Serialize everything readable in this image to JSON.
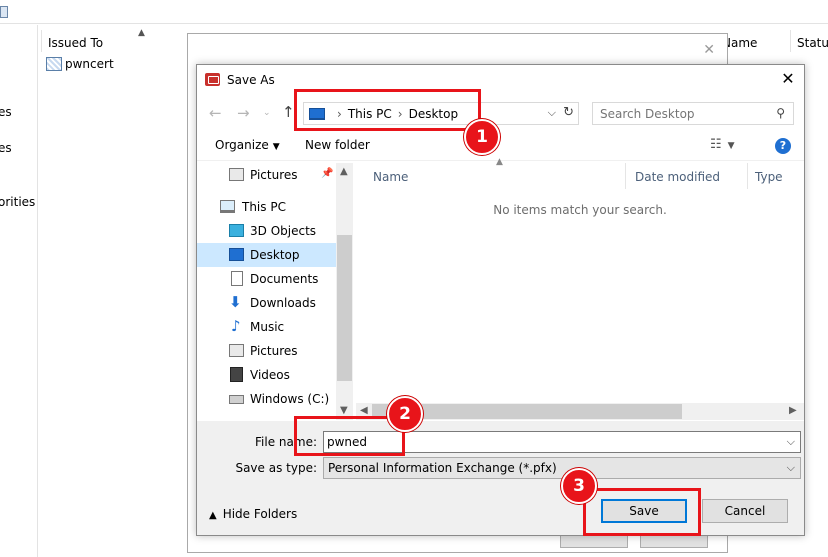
{
  "background": {
    "columns": {
      "issued_to": "Issued To",
      "name": "Name",
      "status": "Status"
    },
    "row": {
      "issued_to": "pwncert"
    },
    "tree_fragments": [
      "es",
      "es",
      "orities"
    ]
  },
  "dialog": {
    "title": "Save As",
    "breadcrumb": [
      "This PC",
      "Desktop"
    ],
    "search_placeholder": "Search Desktop",
    "toolbar": {
      "organize": "Organize",
      "new_folder": "New folder"
    },
    "nav_items": [
      {
        "label": "Pictures",
        "icon": "pictures-icon",
        "indent": 1,
        "pinned": true
      },
      {
        "label": "This PC",
        "icon": "this-pc-icon",
        "indent": 0
      },
      {
        "label": "3D Objects",
        "icon": "3d-objects-icon",
        "indent": 1
      },
      {
        "label": "Desktop",
        "icon": "desktop-icon",
        "indent": 1,
        "selected": true
      },
      {
        "label": "Documents",
        "icon": "documents-icon",
        "indent": 1
      },
      {
        "label": "Downloads",
        "icon": "downloads-icon",
        "indent": 1
      },
      {
        "label": "Music",
        "icon": "music-icon",
        "indent": 1
      },
      {
        "label": "Pictures",
        "icon": "pictures-icon",
        "indent": 1
      },
      {
        "label": "Videos",
        "icon": "videos-icon",
        "indent": 1
      },
      {
        "label": "Windows (C:)",
        "icon": "drive-icon",
        "indent": 1
      }
    ],
    "columns": [
      "Name",
      "Date modified",
      "Type"
    ],
    "empty_message": "No items match your search.",
    "file_name_label": "File name:",
    "file_name_value": "pwned",
    "save_type_label": "Save as type:",
    "save_type_value": "Personal Information Exchange (*.pfx)",
    "hide_folders": "Hide Folders",
    "save_button": "Save",
    "cancel_button": "Cancel"
  },
  "callouts": [
    "1",
    "2",
    "3"
  ],
  "colors": {
    "highlight": "#e8141a",
    "selection": "#cce8ff",
    "accent": "#0078d7"
  }
}
